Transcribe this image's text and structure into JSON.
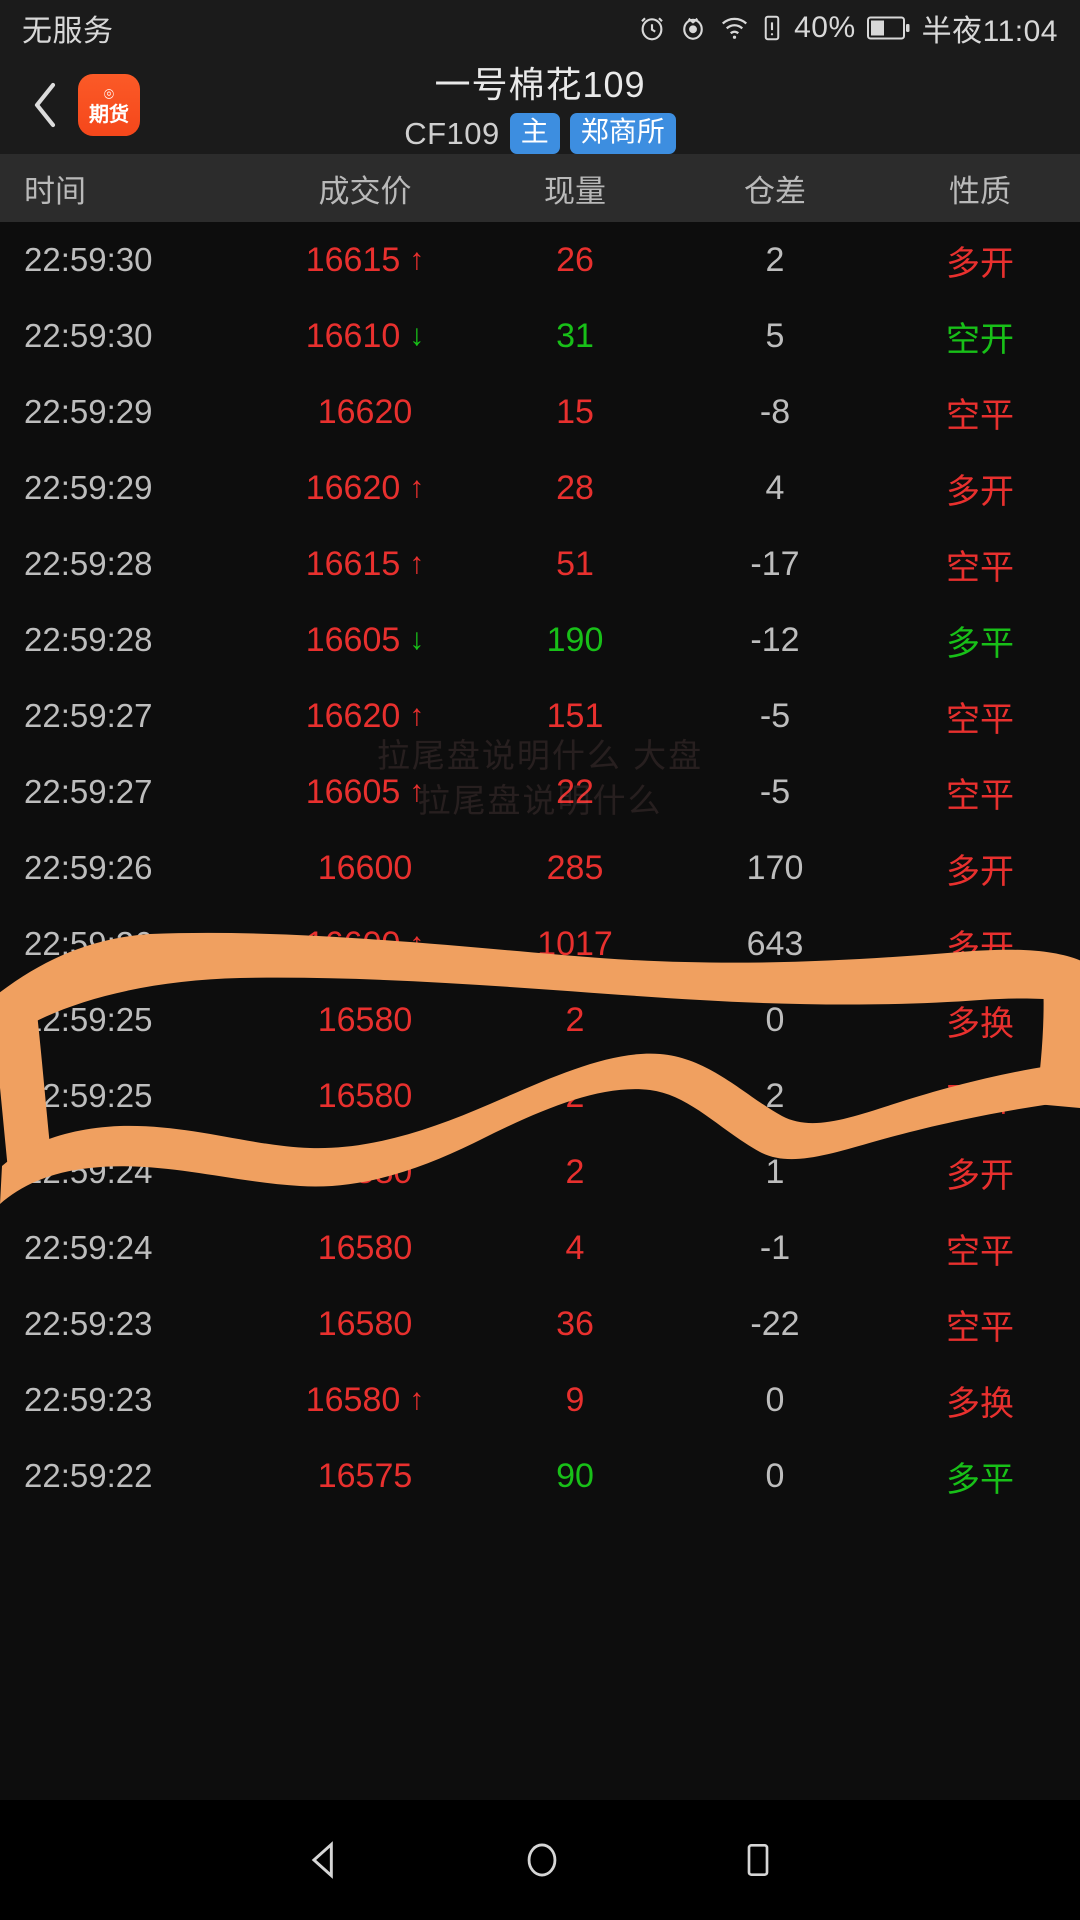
{
  "status_bar": {
    "carrier": "无服务",
    "battery_percent": "40%",
    "time": "半夜11:04",
    "icons": [
      "alarm-icon",
      "eye-icon",
      "wifi-icon",
      "sim-alert-icon",
      "battery-icon"
    ]
  },
  "title_bar": {
    "back_icon": "chevron-left-icon",
    "app_badge_top": "⌾",
    "app_badge_label": "期货",
    "title": "一号棉花109",
    "code": "CF109",
    "badge_main": "主",
    "badge_exchange": "郑商所"
  },
  "table": {
    "columns": [
      "时间",
      "成交价",
      "现量",
      "仓差",
      "性质"
    ],
    "rows": [
      {
        "time": "22:59:30",
        "price": "16615",
        "arrow": "up",
        "price_color": "up",
        "vol": "26",
        "vol_color": "up",
        "pos": "2",
        "nature": "多开",
        "nature_color": "up"
      },
      {
        "time": "22:59:30",
        "price": "16610",
        "arrow": "down",
        "price_color": "up",
        "vol": "31",
        "vol_color": "down",
        "pos": "5",
        "nature": "空开",
        "nature_color": "down"
      },
      {
        "time": "22:59:29",
        "price": "16620",
        "arrow": "",
        "price_color": "up",
        "vol": "15",
        "vol_color": "up",
        "pos": "-8",
        "nature": "空平",
        "nature_color": "up"
      },
      {
        "time": "22:59:29",
        "price": "16620",
        "arrow": "up",
        "price_color": "up",
        "vol": "28",
        "vol_color": "up",
        "pos": "4",
        "nature": "多开",
        "nature_color": "up"
      },
      {
        "time": "22:59:28",
        "price": "16615",
        "arrow": "up",
        "price_color": "up",
        "vol": "51",
        "vol_color": "up",
        "pos": "-17",
        "nature": "空平",
        "nature_color": "up"
      },
      {
        "time": "22:59:28",
        "price": "16605",
        "arrow": "down",
        "price_color": "up",
        "vol": "190",
        "vol_color": "down",
        "pos": "-12",
        "nature": "多平",
        "nature_color": "down"
      },
      {
        "time": "22:59:27",
        "price": "16620",
        "arrow": "up",
        "price_color": "up",
        "vol": "151",
        "vol_color": "up",
        "pos": "-5",
        "nature": "空平",
        "nature_color": "up"
      },
      {
        "time": "22:59:27",
        "price": "16605",
        "arrow": "up",
        "price_color": "up",
        "vol": "22",
        "vol_color": "up",
        "pos": "-5",
        "nature": "空平",
        "nature_color": "up"
      },
      {
        "time": "22:59:26",
        "price": "16600",
        "arrow": "",
        "price_color": "up",
        "vol": "285",
        "vol_color": "up",
        "pos": "170",
        "nature": "多开",
        "nature_color": "up"
      },
      {
        "time": "22:59:26",
        "price": "16600",
        "arrow": "up",
        "price_color": "up",
        "vol": "1017",
        "vol_color": "up",
        "pos": "643",
        "nature": "多开",
        "nature_color": "up"
      },
      {
        "time": "22:59:25",
        "price": "16580",
        "arrow": "",
        "price_color": "up",
        "vol": "2",
        "vol_color": "up",
        "pos": "0",
        "nature": "多换",
        "nature_color": "up"
      },
      {
        "time": "22:59:25",
        "price": "16580",
        "arrow": "",
        "price_color": "up",
        "vol": "2",
        "vol_color": "up",
        "pos": "2",
        "nature": "双开",
        "nature_color": "up"
      },
      {
        "time": "22:59:24",
        "price": "16580",
        "arrow": "",
        "price_color": "up",
        "vol": "2",
        "vol_color": "up",
        "pos": "1",
        "nature": "多开",
        "nature_color": "up"
      },
      {
        "time": "22:59:24",
        "price": "16580",
        "arrow": "",
        "price_color": "up",
        "vol": "4",
        "vol_color": "up",
        "pos": "-1",
        "nature": "空平",
        "nature_color": "up"
      },
      {
        "time": "22:59:23",
        "price": "16580",
        "arrow": "",
        "price_color": "up",
        "vol": "36",
        "vol_color": "up",
        "pos": "-22",
        "nature": "空平",
        "nature_color": "up"
      },
      {
        "time": "22:59:23",
        "price": "16580",
        "arrow": "up",
        "price_color": "up",
        "vol": "9",
        "vol_color": "up",
        "pos": "0",
        "nature": "多换",
        "nature_color": "up"
      },
      {
        "time": "22:59:22",
        "price": "16575",
        "arrow": "",
        "price_color": "up",
        "vol": "90",
        "vol_color": "down",
        "pos": "0",
        "nature": "多平",
        "nature_color": "down"
      }
    ]
  },
  "watermark": {
    "line1": "拉尾盘说明什么 大盘",
    "line2": "拉尾盘说明什么"
  },
  "annotation": {
    "color": "#f0a060",
    "shape": "hand-drawn-circle"
  },
  "nav_bar": {
    "back": "nav-back-icon",
    "home": "nav-home-icon",
    "recents": "nav-recents-icon"
  },
  "colors": {
    "up": "#e8302e",
    "down": "#18c018",
    "neutral": "#bdbdbd",
    "badge_blue": "#3d8ee0",
    "app_orange": "#f5471b",
    "annotation_orange": "#f0a060"
  }
}
